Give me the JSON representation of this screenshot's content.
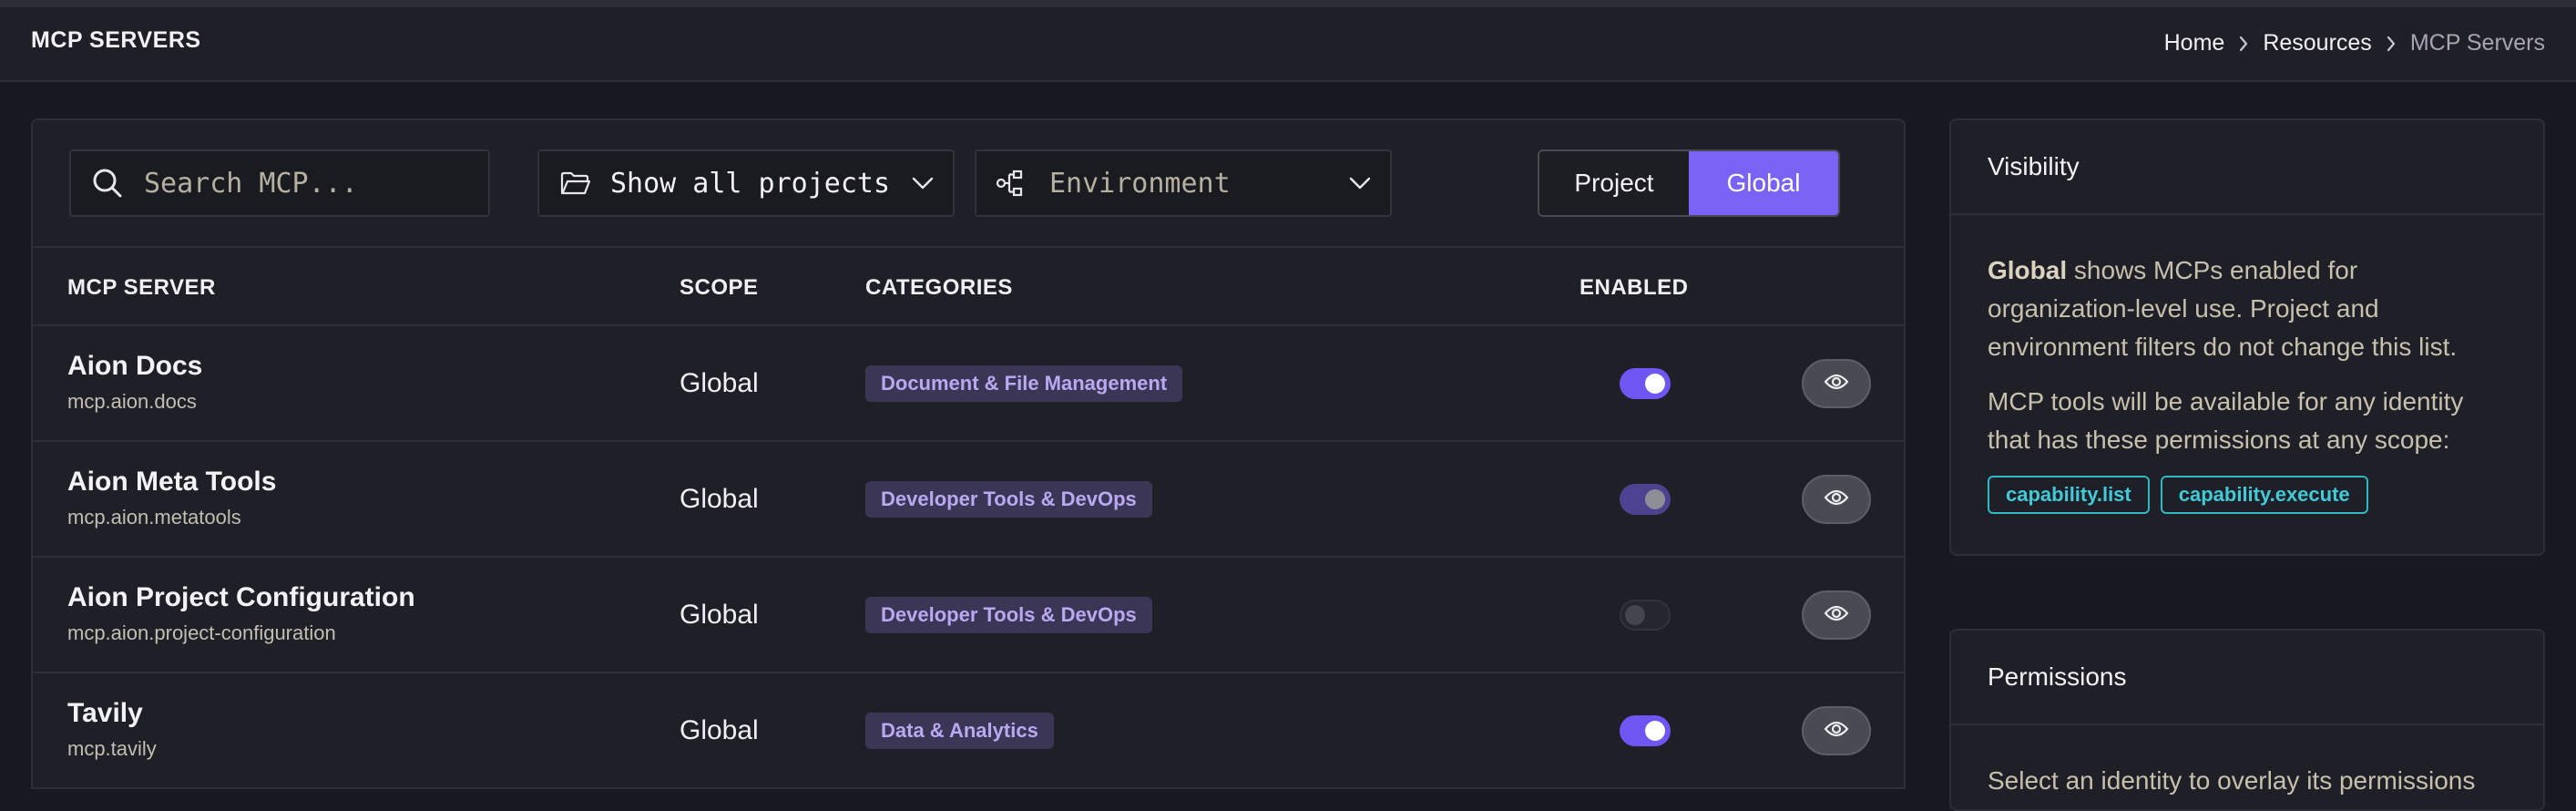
{
  "header": {
    "title": "MCP SERVERS",
    "breadcrumb": [
      "Home",
      "Resources",
      "MCP Servers"
    ]
  },
  "toolbar": {
    "search_placeholder": "Search MCP...",
    "project_filter": "Show all projects",
    "environment_placeholder": "Environment",
    "scope_toggle": {
      "options": [
        "Project",
        "Global"
      ],
      "selected": "Global"
    }
  },
  "table": {
    "columns": {
      "server": "MCP SERVER",
      "scope": "SCOPE",
      "categories": "CATEGORIES",
      "enabled": "ENABLED"
    },
    "rows": [
      {
        "name": "Aion Docs",
        "id": "mcp.aion.docs",
        "scope": "Global",
        "category": "Document & File Management",
        "enabled": "on"
      },
      {
        "name": "Aion Meta Tools",
        "id": "mcp.aion.metatools",
        "scope": "Global",
        "category": "Developer Tools & DevOps",
        "enabled": "on-disabled"
      },
      {
        "name": "Aion Project Configuration",
        "id": "mcp.aion.project-configuration",
        "scope": "Global",
        "category": "Developer Tools & DevOps",
        "enabled": "off"
      },
      {
        "name": "Tavily",
        "id": "mcp.tavily",
        "scope": "Global",
        "category": "Data & Analytics",
        "enabled": "on"
      }
    ]
  },
  "visibility": {
    "title": "Visibility",
    "highlight": "Global",
    "text1": " shows MCPs enabled for organization-level use. Project and environment filters do not change this list.",
    "text2": "MCP tools will be available for any identity that has these permissions at any scope:",
    "permissions": [
      "capability.list",
      "capability.execute"
    ]
  },
  "permissions_panel": {
    "title": "Permissions",
    "text": "Select an identity to overlay its permissions"
  },
  "colors": {
    "accent": "#7a62f5",
    "tag_bg": "#3b3656",
    "tag_text": "#b9a9f0",
    "permission_tag": "#2fb8c6"
  },
  "icons": [
    "search-icon",
    "folder-icon",
    "environment-icon",
    "chevron-down-icon",
    "chevron-right-icon",
    "eye-icon"
  ]
}
